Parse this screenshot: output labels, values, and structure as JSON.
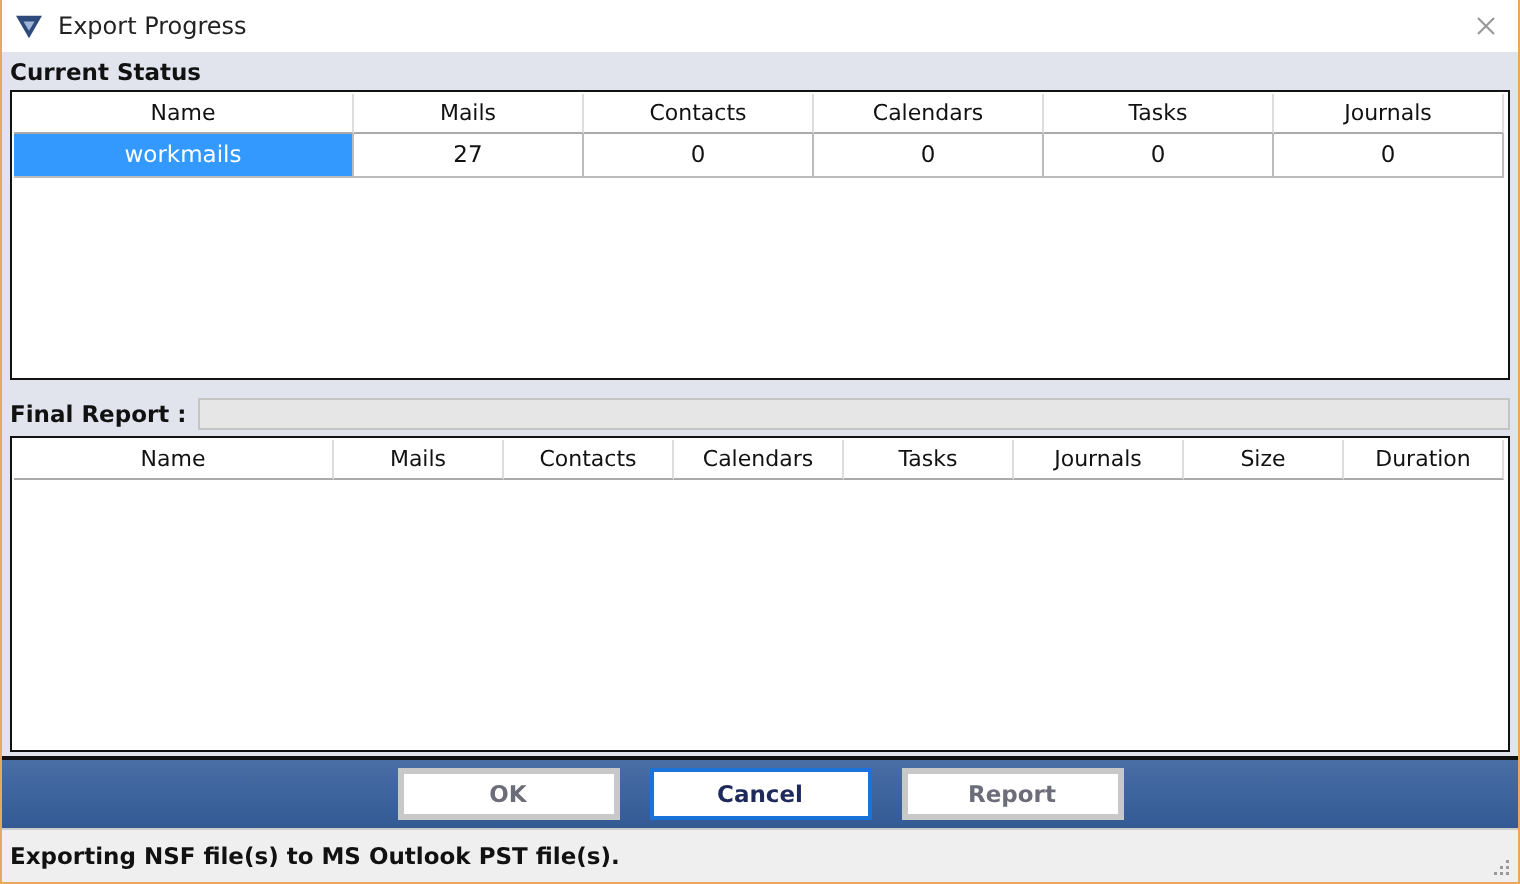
{
  "window": {
    "title": "Export Progress"
  },
  "current_status": {
    "title": "Current Status",
    "columns": [
      "Name",
      "Mails",
      "Contacts",
      "Calendars",
      "Tasks",
      "Journals"
    ],
    "rows": [
      {
        "cells": [
          "workmails",
          "27",
          "0",
          "0",
          "0",
          "0"
        ],
        "selected": true
      }
    ]
  },
  "final_report": {
    "label": "Final Report :",
    "level": 0,
    "columns": [
      "Name",
      "Mails",
      "Contacts",
      "Calendars",
      "Tasks",
      "Journals",
      "Size",
      "Duration"
    ]
  },
  "buttons": [
    {
      "label": "OK",
      "disabled": true,
      "focused": false
    },
    {
      "label": "Cancel",
      "disabled": false,
      "focused": true
    },
    {
      "label": "Report",
      "disabled": true,
      "focused": false
    }
  ],
  "status_bar": "Exporting NSF file(s) to MS Outlook PST file(s)."
}
